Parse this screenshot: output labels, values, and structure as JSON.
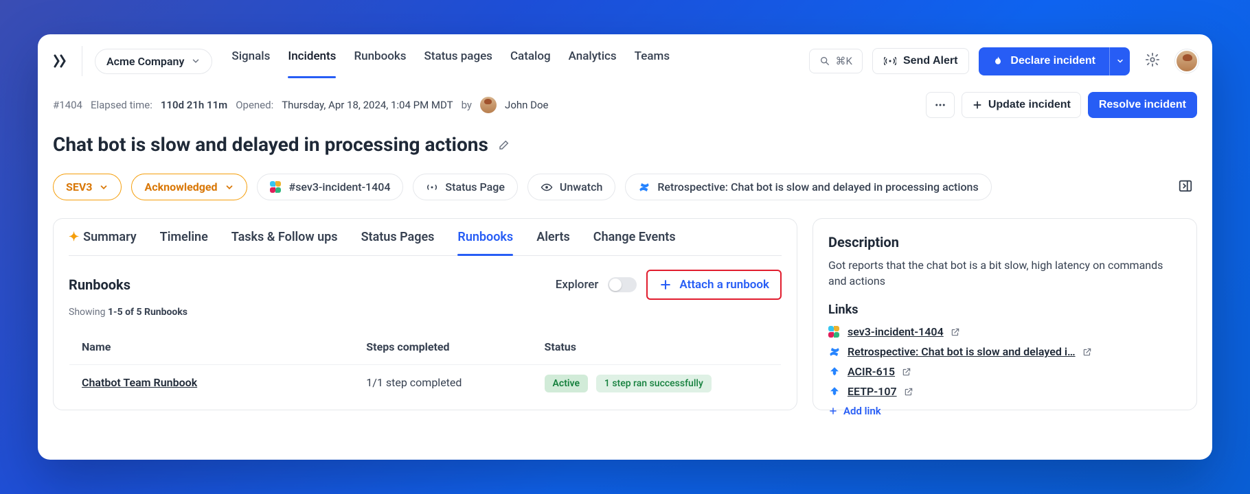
{
  "company": "Acme Company",
  "nav": {
    "signals": "Signals",
    "incidents": "Incidents",
    "runbooks": "Runbooks",
    "status_pages": "Status pages",
    "catalog": "Catalog",
    "analytics": "Analytics",
    "teams": "Teams"
  },
  "search_shortcut": "⌘K",
  "send_alert": "Send Alert",
  "declare_incident": "Declare incident",
  "incident_id": "#1404",
  "elapsed_label": "Elapsed time:",
  "elapsed_value": "110d 21h 11m",
  "opened_label": "Opened:",
  "opened_value": "Thursday, Apr 18, 2024, 1:04 PM MDT",
  "by_label": "by",
  "opened_by": "John Doe",
  "update_incident": "Update incident",
  "resolve_incident": "Resolve incident",
  "title": "Chat bot is slow and delayed in processing actions",
  "severity": "SEV3",
  "status": "Acknowledged",
  "slack_channel": "#sev3-incident-1404",
  "status_page_chip": "Status Page",
  "unwatch": "Unwatch",
  "retrospective": "Retrospective: Chat bot is slow and delayed in processing actions",
  "tabs": {
    "summary": "Summary",
    "timeline": "Timeline",
    "tasks": "Tasks & Follow ups",
    "status_pages": "Status Pages",
    "runbooks": "Runbooks",
    "alerts": "Alerts",
    "change_events": "Change Events"
  },
  "runbooks_section": {
    "title": "Runbooks",
    "explorer_label": "Explorer",
    "attach_label": "Attach a runbook",
    "showing_prefix": "Showing",
    "showing_bold": "1-5 of 5 Runbooks",
    "col_name": "Name",
    "col_steps": "Steps completed",
    "col_status": "Status",
    "row1_name": "Chatbot Team Runbook",
    "row1_steps": "1/1 step completed",
    "row1_status": "Active",
    "row1_badge": "1 step ran successfully"
  },
  "sidebar": {
    "description_title": "Description",
    "description_body": "Got reports that the chat bot is a bit slow, high latency on commands and actions",
    "links_title": "Links",
    "link1": "sev3-incident-1404",
    "link2": "Retrospective: Chat bot is slow and delayed i…",
    "link3": "ACIR-615",
    "link4": "EETP-107",
    "add_link": "Add link"
  }
}
